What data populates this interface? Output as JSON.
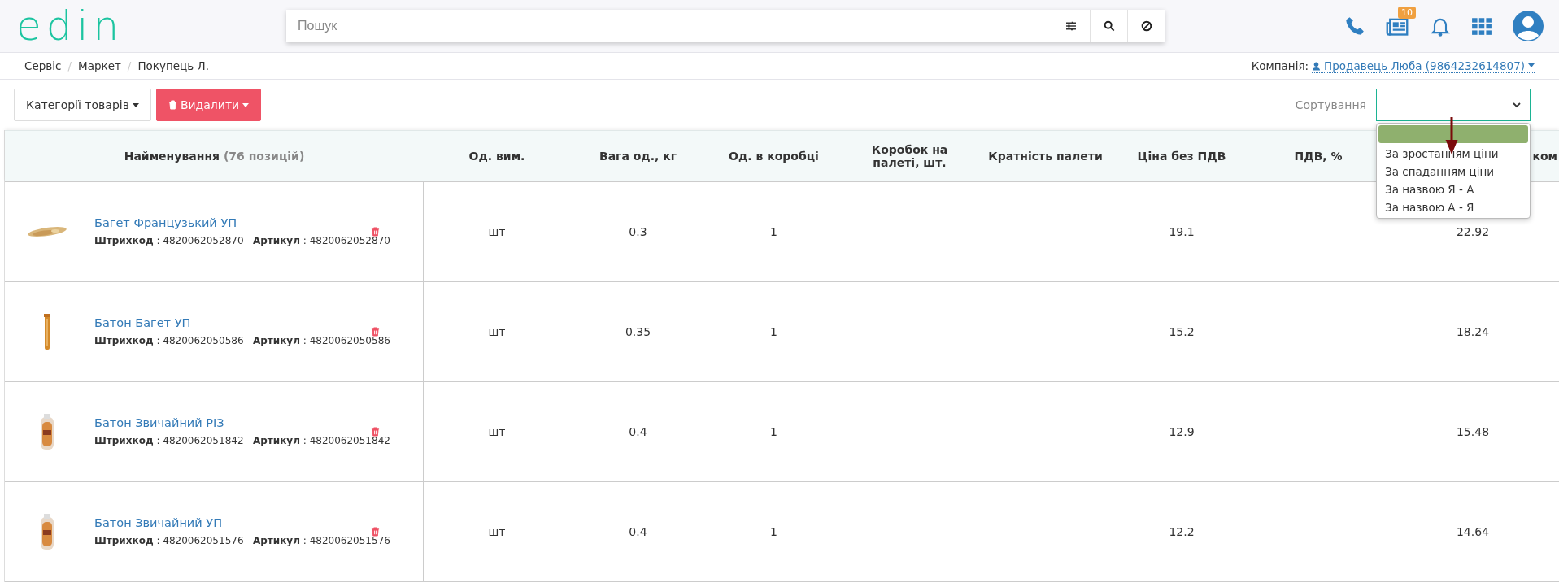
{
  "header": {
    "logo": "edin",
    "search": {
      "placeholder": "Пошук"
    },
    "notification_badge": "10"
  },
  "breadcrumbs": [
    "Сервіс",
    "Маркет",
    "Покупець Л."
  ],
  "breadcrumb_separator": "/",
  "company": {
    "label": "Компанія:",
    "name": "Продавець Люба (9864232614807)"
  },
  "toolbar": {
    "categories_button": "Категорії товарів",
    "delete_button": "Видалити"
  },
  "sort": {
    "label": "Сортування",
    "open": true,
    "blank_option_highlighted": true,
    "options": [
      "За зростанням ціни",
      "За спаданням ціни",
      "За назвою Я - А",
      "За назвою А - Я"
    ]
  },
  "table": {
    "name_column": {
      "label": "Найменування",
      "count": "(76 позицій)"
    },
    "columns": [
      "Од. вим.",
      "Вага од., кг",
      "Од. в коробці",
      "Коробок на палеті, шт.",
      "Кратність палети",
      "Ціна без ПДВ",
      "ПДВ, %",
      "ком"
    ],
    "rows": [
      {
        "name": "Багет Французький УП",
        "codes": "**Штрихкод** : 4820062052870   **Артикул** : 4820062052870",
        "cells": [
          "шт",
          "0.3",
          "1",
          "",
          "",
          "19.1",
          "",
          "22.92"
        ]
      },
      {
        "name": "Батон Багет УП",
        "codes": "**Штрихкод** : 4820062050586   **Артикул** : 4820062050586",
        "cells": [
          "шт",
          "0.35",
          "1",
          "",
          "",
          "15.2",
          "",
          "18.24"
        ]
      },
      {
        "name": "Батон Звичайний РІЗ",
        "codes": "**Штрихкод** : 4820062051842   **Артикул** : 4820062051842",
        "cells": [
          "шт",
          "0.4",
          "1",
          "",
          "",
          "12.9",
          "",
          "15.48"
        ]
      },
      {
        "name": "Батон Звичайний УП",
        "codes": "**Штрихкод** : 4820062051576   **Артикул** : 4820062051576",
        "cells": [
          "шт",
          "0.4",
          "1",
          "",
          "",
          "12.2",
          "",
          "14.64"
        ]
      }
    ]
  }
}
